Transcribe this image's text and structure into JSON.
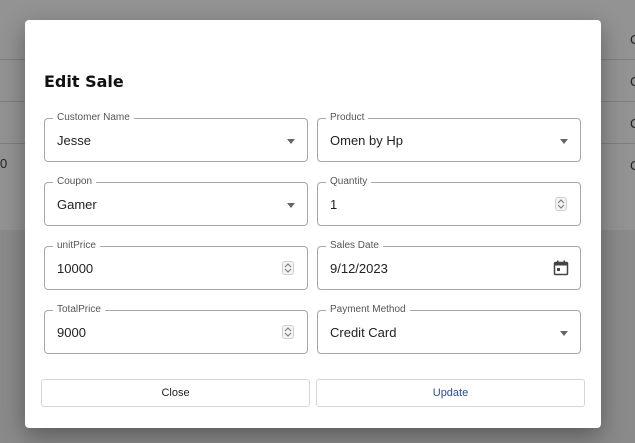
{
  "background": {
    "right_cells": [
      "C",
      "C",
      "C",
      "C"
    ],
    "left_cell": "0",
    "top_row_text": "──── ── ────────          ──── ─────       ────"
  },
  "dialog": {
    "title": "Edit Sale",
    "fields": {
      "customer_name": {
        "label": "Customer Name",
        "value": "Jesse"
      },
      "product": {
        "label": "Product",
        "value": "Omen by Hp"
      },
      "coupon": {
        "label": "Coupon",
        "value": "Gamer"
      },
      "quantity": {
        "label": "Quantity",
        "value": "1"
      },
      "unit_price": {
        "label": "unitPrice",
        "value": "10000"
      },
      "sales_date": {
        "label": "Sales Date",
        "value": "9/12/2023"
      },
      "total_price": {
        "label": "TotalPrice",
        "value": "9000"
      },
      "payment_method": {
        "label": "Payment Method",
        "value": "Credit Card"
      }
    },
    "buttons": {
      "close": "Close",
      "update": "Update"
    }
  },
  "colors": {
    "update_text": "#2c4a8f",
    "close_text": "#222222",
    "overlay": "#8a8a8a"
  },
  "icons": {
    "dropdown": "chevron-down-icon",
    "spinner": "number-spinner-icon",
    "calendar": "calendar-icon"
  }
}
